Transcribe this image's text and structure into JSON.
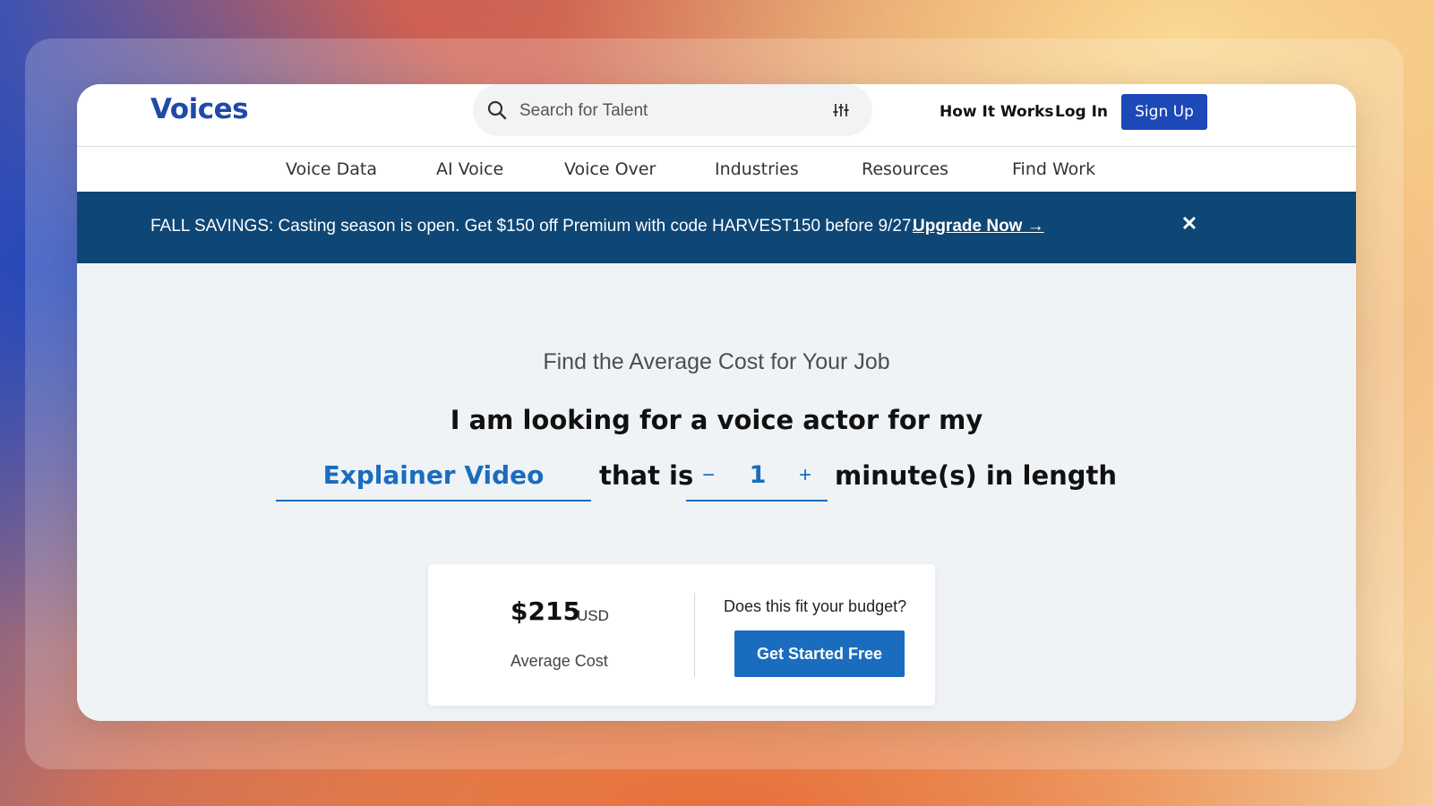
{
  "brand": {
    "name": "Voices"
  },
  "search": {
    "placeholder": "Search for Talent"
  },
  "header": {
    "how_it_works": "How It Works",
    "log_in": "Log In",
    "sign_up": "Sign Up"
  },
  "nav": {
    "items": [
      {
        "label": "Voice Data"
      },
      {
        "label": "AI Voice"
      },
      {
        "label": "Voice Over"
      },
      {
        "label": "Industries"
      },
      {
        "label": "Resources"
      },
      {
        "label": "Find Work"
      }
    ]
  },
  "promo": {
    "text": "FALL SAVINGS: Casting season is open. Get $150 off Premium with code HARVEST150 before 9/27.",
    "link": "Upgrade Now →",
    "close": "✕"
  },
  "main": {
    "subtitle": "Find the Average Cost for Your Job",
    "headline": "I am looking for a voice actor for my",
    "job_type": "Explainer Video",
    "that_is": "that is",
    "minus": "−",
    "minutes": "1",
    "plus": "+",
    "length_text": "minute(s) in length"
  },
  "estimate": {
    "price": "$215",
    "currency": "USD",
    "label": "Average Cost",
    "question": "Does this fit your budget?",
    "cta": "Get Started Free"
  },
  "colors": {
    "brand_blue": "#1f4aa8",
    "promo_bg": "#0e4675",
    "accent_blue": "#1a6dbe"
  }
}
